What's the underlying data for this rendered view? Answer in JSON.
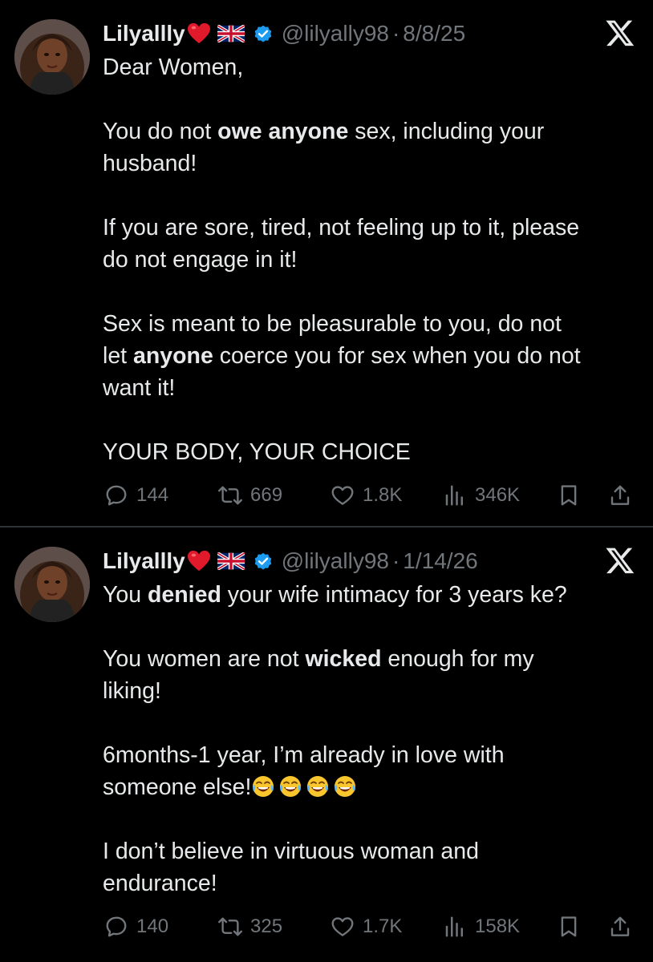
{
  "colors": {
    "background": "#000000",
    "divider": "#2f3336",
    "text": "#e7e9ea",
    "muted": "#71767b",
    "verified": "#1d9bf0",
    "heart": "#e0192b"
  },
  "tweets": [
    {
      "author": {
        "name": "Lilyallly",
        "badges": [
          "red-heart-emoji",
          "uk-flag-emoji",
          "verified-icon"
        ],
        "handle": "@lilyally98",
        "separator": "·",
        "date": "8/8/25"
      },
      "body": {
        "l1": "Dear Women,",
        "p2a": "You do not ",
        "p2b": "owe anyone",
        "p2c": " sex, including your",
        "p2d": "husband!",
        "p3a": "If you are sore, tired, not feeling up to it, please",
        "p3b": "do not engage in it!",
        "p4a": "Sex is meant to be pleasurable to you, do not",
        "p4b": "let ",
        "p4c": "anyone",
        "p4d": " coerce you for sex when you do not",
        "p4e": "want it!",
        "p5": "YOUR BODY, YOUR CHOICE"
      },
      "stats": {
        "replies": "144",
        "reposts": "669",
        "likes": "1.8K",
        "views": "346K"
      }
    },
    {
      "author": {
        "name": "Lilyallly",
        "badges": [
          "red-heart-emoji",
          "uk-flag-emoji",
          "verified-icon"
        ],
        "handle": "@lilyally98",
        "separator": "·",
        "date": "1/14/26"
      },
      "body": {
        "p1a": "You ",
        "p1b": "denied",
        "p1c": " your wife intimacy for 3 years ke?",
        "p2a": "You women are not ",
        "p2b": "wicked",
        "p2c": " enough for my",
        "p2d": "liking!",
        "p3a": "6months-1 year, I’m already in love with",
        "p3b": "someone else!",
        "p3_emojis": [
          "face-with-tears-of-joy",
          "face-with-tears-of-joy",
          "face-with-tears-of-joy",
          "face-with-tears-of-joy"
        ],
        "p4a": "I don’t believe in virtuous woman and",
        "p4b": "endurance!"
      },
      "stats": {
        "replies": "140",
        "reposts": "325",
        "likes": "1.7K",
        "views": "158K"
      }
    }
  ]
}
